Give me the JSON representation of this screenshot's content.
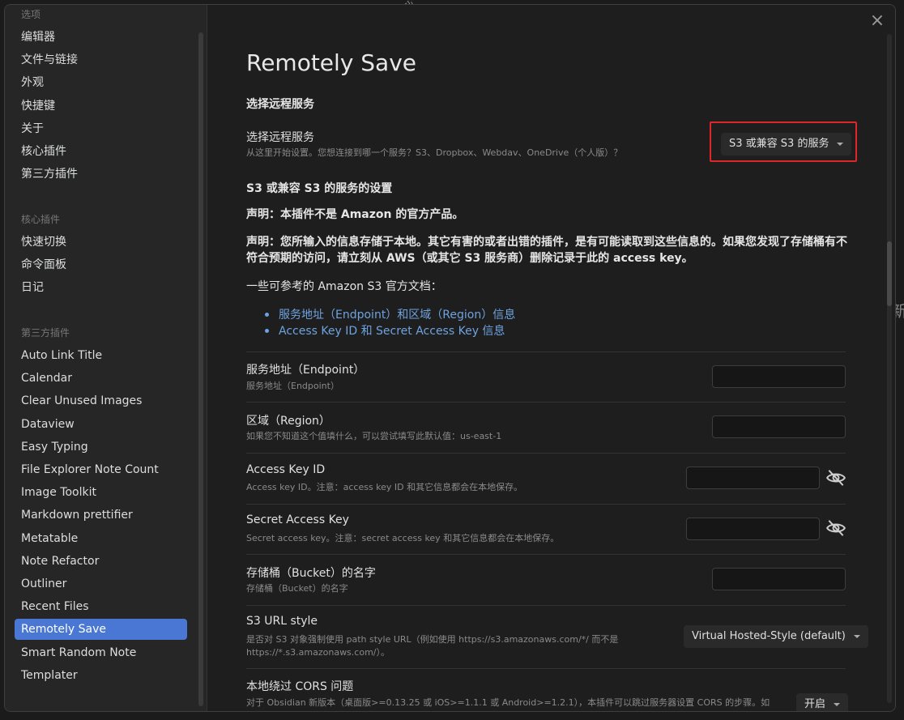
{
  "sidebar": {
    "groups": {
      "options": "选项",
      "core_plugins": "核心插件",
      "third_party": "第三方插件"
    },
    "options_items": [
      "编辑器",
      "文件与链接",
      "外观",
      "快捷键",
      "关于",
      "核心插件",
      "第三方插件"
    ],
    "core_items": [
      "快速切换",
      "命令面板",
      "日记"
    ],
    "third_party_items": [
      "Auto Link Title",
      "Calendar",
      "Clear Unused Images",
      "Dataview",
      "Easy Typing",
      "File Explorer Note Count",
      "Image Toolkit",
      "Markdown prettifier",
      "Metatable",
      "Note Refactor",
      "Outliner",
      "Recent Files",
      "Remotely Save",
      "Smart Random Note",
      "Templater"
    ],
    "active_item": "Remotely Save"
  },
  "content": {
    "close_icon": "×",
    "title": "Remotely Save",
    "section_remote": "选择远程服务",
    "remote_service": {
      "name": "选择远程服务",
      "desc": "从这里开始设置。您想连接到哪一个服务？S3、Dropbox、Webdav、OneDrive（个人版）？",
      "selected": "S3 或兼容 S3 的服务"
    },
    "section_s3": "S3 或兼容 S3 的服务的设置",
    "disclaimer1": "声明：本插件不是 Amazon 的官方产品。",
    "disclaimer2": "声明：您所输入的信息存储于本地。其它有害的或者出错的插件，是有可能读取到这些信息的。如果您发现了存储桶有不符合预期的访问，请立刻从 AWS（或其它 S3 服务商）删除记录于此的 access key。",
    "docs_intro": "一些可参考的 Amazon S3 官方文档：",
    "docs_links": [
      "服务地址（Endpoint）和区域（Region）信息",
      "Access Key ID 和 Secret Access Key 信息"
    ],
    "settings": {
      "endpoint": {
        "name": "服务地址（Endpoint）",
        "desc": "服务地址（Endpoint）",
        "value": ""
      },
      "region": {
        "name": "区域（Region）",
        "desc": "如果您不知道这个值填什么，可以尝试填写此默认值：us-east-1",
        "value": ""
      },
      "access_key": {
        "name": "Access Key ID",
        "desc": "Access key ID。注意：access key ID 和其它信息都会在本地保存。",
        "value": ""
      },
      "secret_key": {
        "name": "Secret Access Key",
        "desc": "Secret access key。注意：secret access key 和其它信息都会在本地保存。",
        "value": ""
      },
      "bucket": {
        "name": "存储桶（Bucket）的名字",
        "desc": "存储桶（Bucket）的名字",
        "value": ""
      },
      "url_style": {
        "name": "S3 URL style",
        "desc_line1": "是否对 S3 对象强制使用 path style URL（例如使用 https://s3.amazonaws.com/*/ 而不是",
        "desc_line2": "https://*.s3.amazonaws.com/）。",
        "selected": "Virtual Hosted-Style (default)"
      },
      "cors": {
        "name": "本地绕过 CORS 问题",
        "desc": "对于 Obsidian 新版本（桌面版>=0.13.25 或 iOS>=1.1.1 或 Android>=1.2.1），本插件可以跳过服务器设置 CORS 的步骤。如",
        "selected": "开启"
      }
    }
  },
  "background": {
    "frag_top": "ぶ",
    "frag_right": "新"
  }
}
